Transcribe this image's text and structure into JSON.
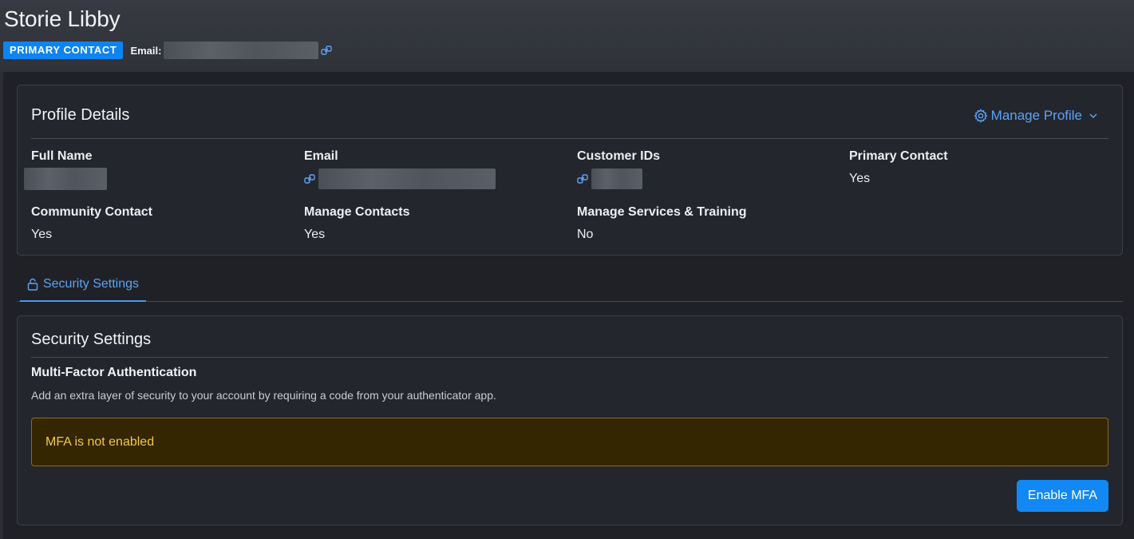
{
  "header": {
    "title": "Storie Libby",
    "badge": "PRIMARY CONTACT",
    "email_label": "Email:"
  },
  "profile": {
    "title": "Profile Details",
    "manage_label": "Manage Profile",
    "fields": {
      "full_name": {
        "label": "Full Name",
        "value": ""
      },
      "email": {
        "label": "Email",
        "value": ""
      },
      "customer_ids": {
        "label": "Customer IDs",
        "value": ""
      },
      "primary_contact": {
        "label": "Primary Contact",
        "value": "Yes"
      },
      "community_contact": {
        "label": "Community Contact",
        "value": "Yes"
      },
      "manage_contacts": {
        "label": "Manage Contacts",
        "value": "Yes"
      },
      "manage_services": {
        "label": "Manage Services & Training",
        "value": "No"
      }
    }
  },
  "tabs": [
    {
      "label": "Security Settings",
      "icon": "lock-icon",
      "active": true
    }
  ],
  "security": {
    "title": "Security Settings",
    "mfa_heading": "Multi-Factor Authentication",
    "mfa_description": "Add an extra layer of security to your account by requiring a code from your authenticator app.",
    "mfa_status": "MFA is not enabled",
    "enable_button": "Enable MFA"
  },
  "colors": {
    "accent": "#1288f5",
    "link": "#5aa3f7",
    "warning_text": "#f3c846",
    "warning_bg": "#332600"
  }
}
